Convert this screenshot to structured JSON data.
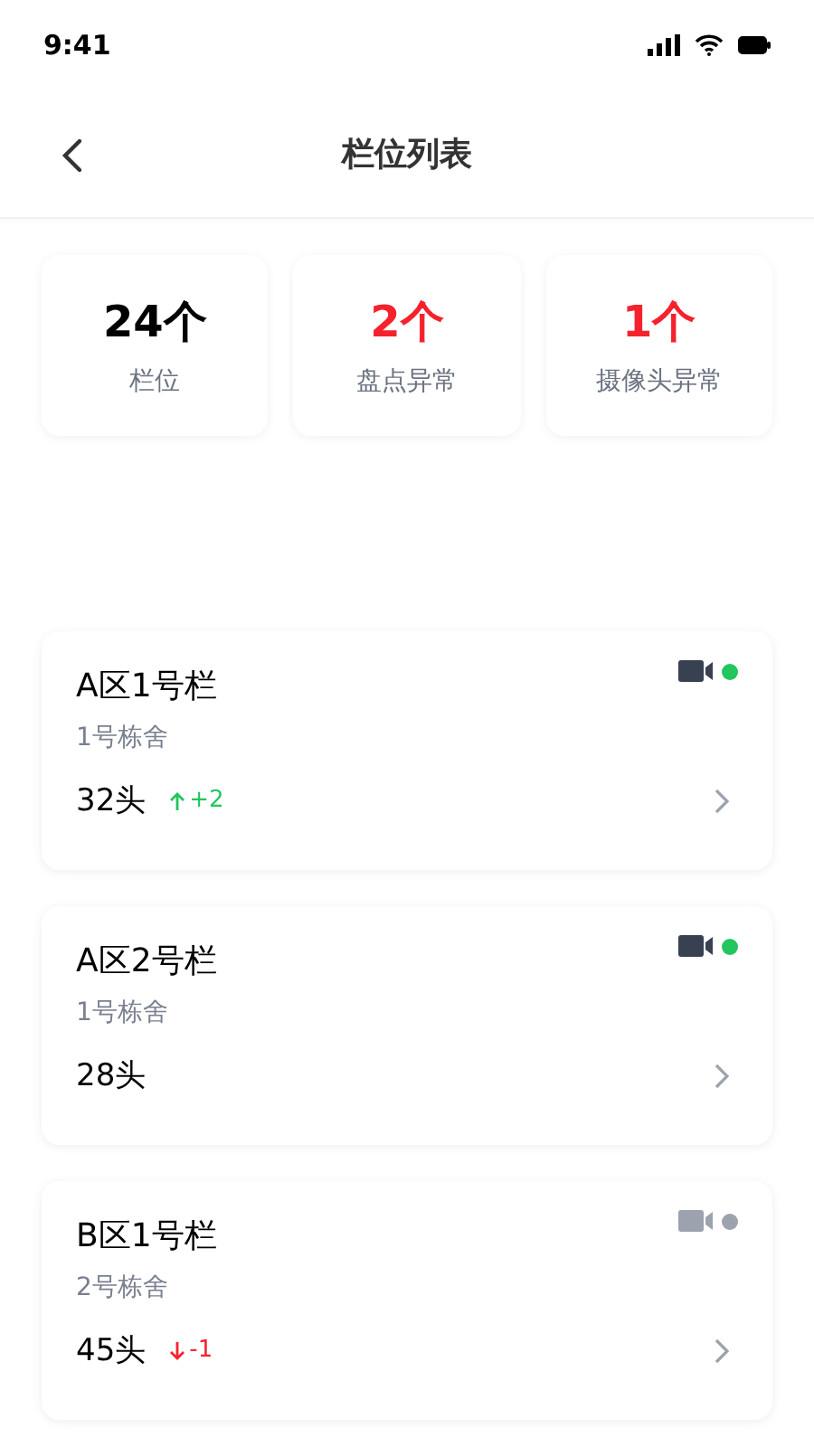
{
  "status_bar": {
    "time": "9:41"
  },
  "header": {
    "title": "栏位列表"
  },
  "stats": [
    {
      "value": "24个",
      "label": "栏位",
      "alert": false
    },
    {
      "value": "2个",
      "label": "盘点异常",
      "alert": true
    },
    {
      "value": "1个",
      "label": "摄像头异常",
      "alert": true
    }
  ],
  "pens": [
    {
      "name": "A区1号栏",
      "barn": "1号栋舍",
      "count": "32头",
      "camera_online": true,
      "change": {
        "kind": "up",
        "text": "+2"
      }
    },
    {
      "name": "A区2号栏",
      "barn": "1号栋舍",
      "count": "28头",
      "camera_online": true
    },
    {
      "name": "B区1号栏",
      "barn": "2号栋舍",
      "count": "45头",
      "camera_online": false,
      "change": {
        "kind": "down",
        "text": "-1"
      }
    }
  ]
}
